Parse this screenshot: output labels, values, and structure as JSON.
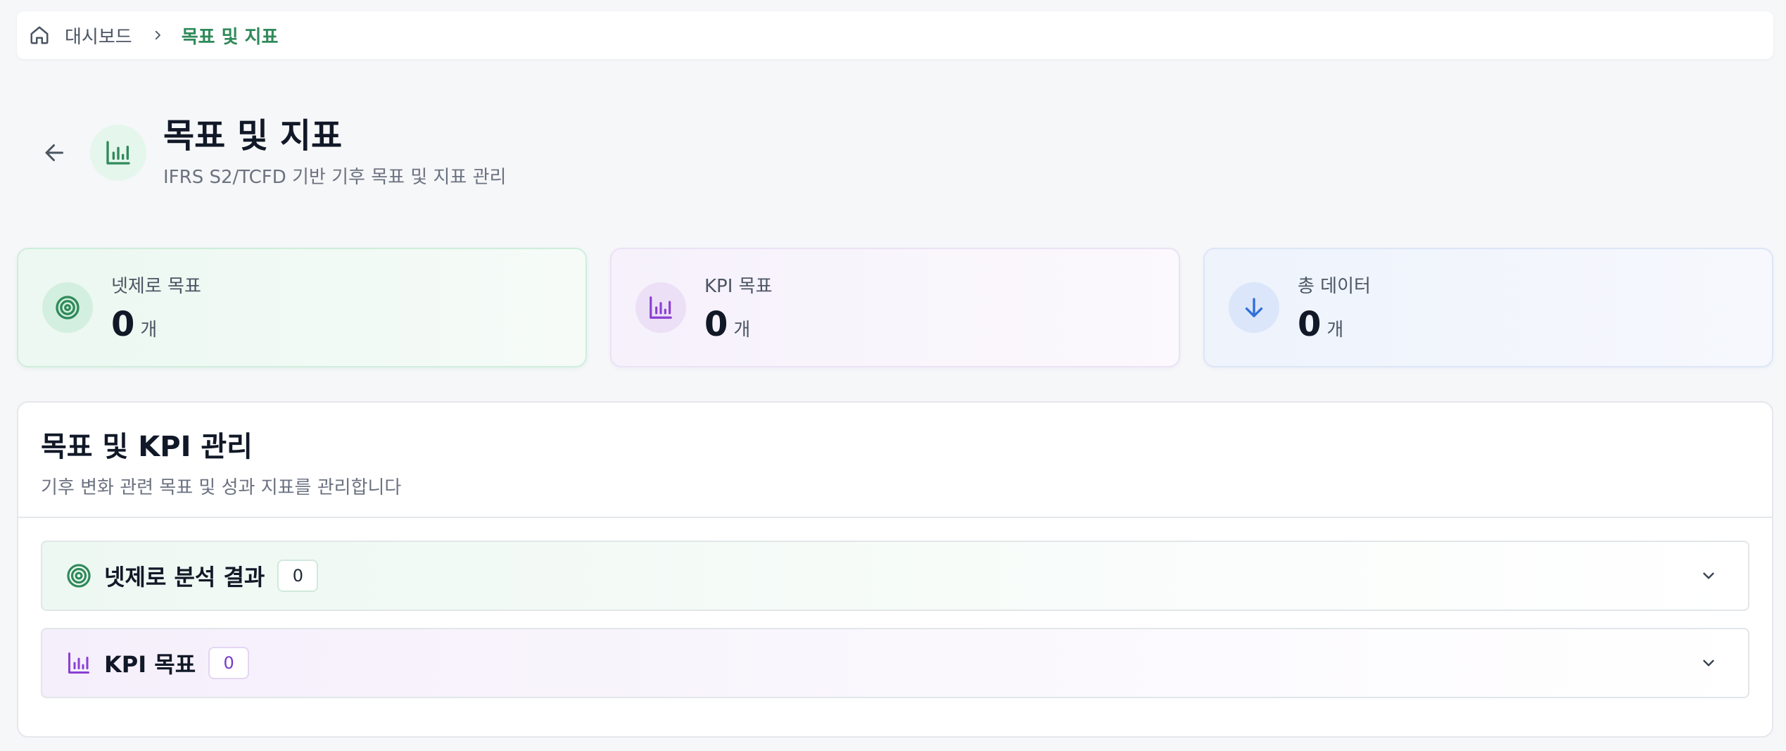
{
  "breadcrumb": {
    "home_icon": "home-icon",
    "items": [
      "대시보드"
    ],
    "current": "목표 및 지표"
  },
  "header": {
    "title": "목표 및 지표",
    "subtitle": "IFRS S2/TCFD 기반 기후 목표 및 지표 관리",
    "icon": "bar-chart-icon"
  },
  "stats": [
    {
      "label": "넷제로 목표",
      "value": "0",
      "unit": "개",
      "icon": "target-icon",
      "color": "#2f8a5a"
    },
    {
      "label": "KPI 목표",
      "value": "0",
      "unit": "개",
      "icon": "bar-chart-icon",
      "color": "#8b3fd1"
    },
    {
      "label": "총 데이터",
      "value": "0",
      "unit": "개",
      "icon": "arrow-down-icon",
      "color": "#2f6fd9"
    }
  ],
  "panel": {
    "title": "목표 및 KPI 관리",
    "subtitle": "기후 변화 관련 목표 및 성과 지표를 관리합니다",
    "sections": [
      {
        "label": "넷제로 분석 결과",
        "count": "0",
        "icon": "target-icon"
      },
      {
        "label": "KPI 목표",
        "count": "0",
        "icon": "bar-chart-icon"
      }
    ]
  }
}
